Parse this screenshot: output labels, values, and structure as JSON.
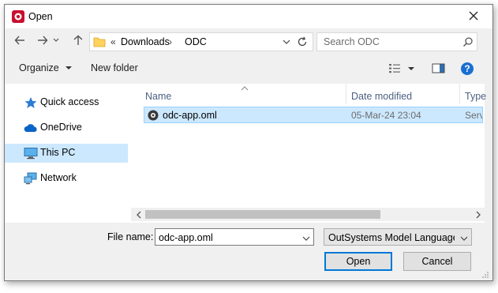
{
  "window": {
    "title": "Open"
  },
  "address": {
    "overflow": "«",
    "path": [
      "Downloads",
      "ODC"
    ]
  },
  "search": {
    "placeholder": "Search ODC"
  },
  "toolbar": {
    "organize": "Organize",
    "new_folder": "New folder"
  },
  "sidebar": {
    "items": [
      {
        "label": "Quick access",
        "icon": "star-icon",
        "selected": false
      },
      {
        "label": "OneDrive",
        "icon": "cloud-icon",
        "selected": false
      },
      {
        "label": "This PC",
        "icon": "computer-icon",
        "selected": true
      },
      {
        "label": "Network",
        "icon": "network-icon",
        "selected": false
      }
    ]
  },
  "columns": {
    "name": "Name",
    "date": "Date modified",
    "type": "Type"
  },
  "files": [
    {
      "name": "odc-app.oml",
      "date": "05-Mar-24 23:04",
      "type": "Servic"
    }
  ],
  "footer": {
    "file_name_label": "File name:",
    "file_name_value": "odc-app.oml",
    "file_type": "OutSystems Model Language (*",
    "open": "Open",
    "cancel": "Cancel"
  },
  "colors": {
    "accent": "#0078d7",
    "selection": "#cce8ff",
    "folder": "#ffd35c"
  }
}
